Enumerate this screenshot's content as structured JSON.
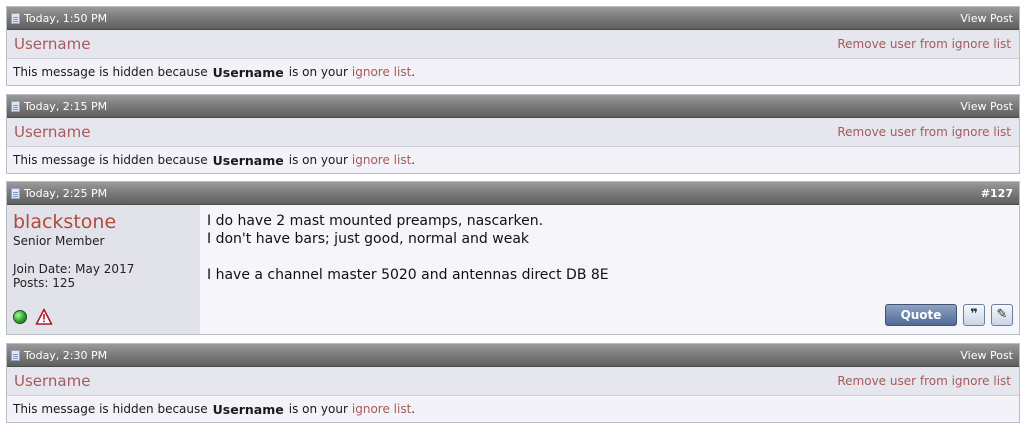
{
  "posts": [
    {
      "type": "ignored",
      "timestamp": "Today, 1:50 PM",
      "view_post": "View Post",
      "username": "Username",
      "remove_link": "Remove user from ignore list",
      "msg_prefix": "This message is hidden because",
      "msg_mid": "is on your",
      "ignore_link": "ignore list",
      "msg_suffix": "."
    },
    {
      "type": "ignored",
      "timestamp": "Today, 2:15 PM",
      "view_post": "View Post",
      "username": "Username",
      "remove_link": "Remove user from ignore list",
      "msg_prefix": "This message is hidden because",
      "msg_mid": "is on your",
      "ignore_link": "ignore list",
      "msg_suffix": "."
    },
    {
      "type": "full",
      "timestamp": "Today, 2:25 PM",
      "post_number": "#127",
      "username": "blackstone",
      "user_title": "Senior Member",
      "join_date": "Join Date: May 2017",
      "posts": "Posts: 125",
      "lines": [
        "I do have 2 mast mounted preamps, nascarken.",
        "I don't have bars; just good, normal and weak",
        "I have a channel master 5020 and antennas direct DB 8E"
      ],
      "quote_label": "Quote",
      "icons": [
        "online-status-icon",
        "report-post-icon",
        "multi-quote-icon",
        "quick-reply-icon"
      ]
    },
    {
      "type": "ignored",
      "timestamp": "Today, 2:30 PM",
      "view_post": "View Post",
      "username": "Username",
      "remove_link": "Remove user from ignore list",
      "msg_prefix": "This message is hidden because",
      "msg_mid": "is on your",
      "ignore_link": "ignore list",
      "msg_suffix": "."
    }
  ],
  "colors": {
    "header_gray": "#7d7d7d",
    "link_red": "#a75a5a",
    "username_red": "#b14a3a",
    "panel_bg": "#e6e6ee"
  }
}
